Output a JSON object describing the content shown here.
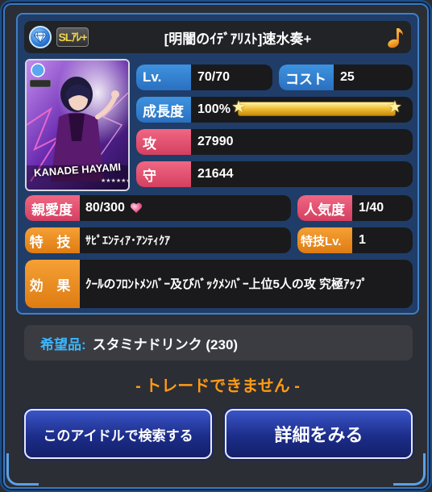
{
  "card": {
    "title": "[明闇のｲﾃﾞｱﾘｽﾄ]速水奏+",
    "rarity": "SLｱﾚ+",
    "attribute_icon": "cool-diamond-icon",
    "thumbnail_caption": "KANADE HAYAMI"
  },
  "stats": {
    "level_label": "Lv.",
    "level_value": "70/70",
    "cost_label": "コスト",
    "cost_value": "25",
    "growth_label": "成長度",
    "growth_value": "100%",
    "growth_fraction": 1.0,
    "attack_label": "攻",
    "attack_value": "27990",
    "defense_label": "守",
    "defense_value": "21644",
    "affection_label": "親愛度",
    "affection_value": "80/300",
    "popularity_label": "人気度",
    "popularity_value": "1/40",
    "skill_label": "特 技",
    "skill_value": "ｻﾋﾟｴﾝﾃｨｱ･ｱﾝﾃｨｸｱ",
    "skill_level_label": "特技Lv.",
    "skill_level_value": "1",
    "effect_label": "効 果",
    "effect_value": "ｸｰﾙのﾌﾛﾝﾄﾒﾝﾊﾞｰ及びﾊﾞｯｸﾒﾝﾊﾞｰ上位5人の攻 究極ｱｯﾌﾟ"
  },
  "wish": {
    "label": "希望品:",
    "value": "スタミナドリンク (230)"
  },
  "trade_message": "- トレードできません -",
  "buttons": {
    "search_label": "このアイドルで検索する",
    "detail_label": "詳細をみる"
  },
  "colors": {
    "blue_label": "#3586d6",
    "pink_label": "#e2506f",
    "orange_label": "#ea8c22",
    "wish_label": "#39b7ff",
    "trade_message": "#ff9a14"
  }
}
